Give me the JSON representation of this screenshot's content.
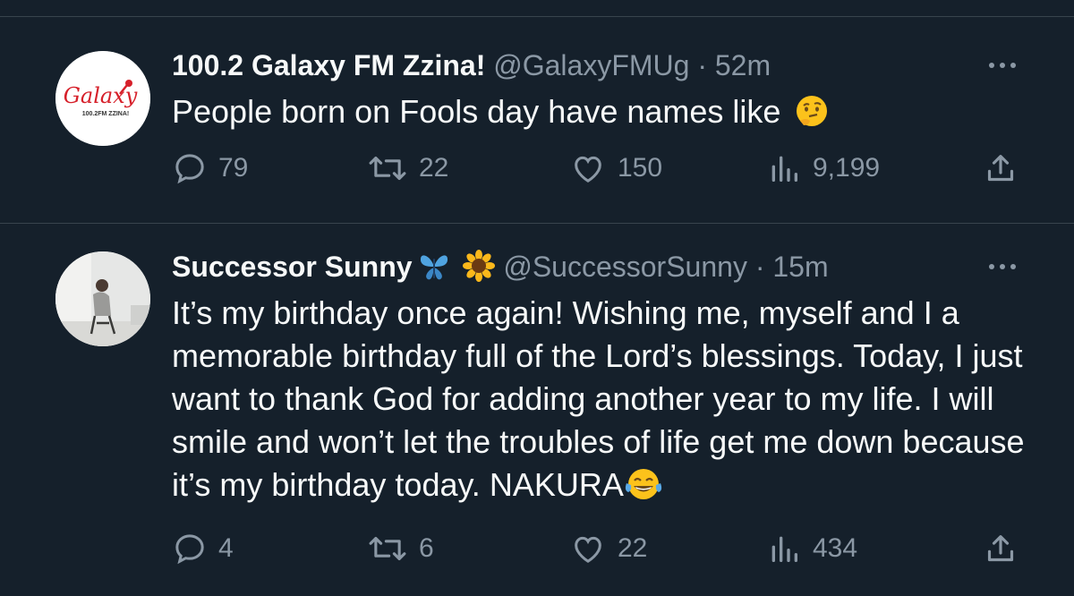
{
  "tweets": [
    {
      "name": "100.2 Galaxy FM Zzina!",
      "handle": "@GalaxyFMUg",
      "separator": "·",
      "time": "52m",
      "text": "People born on Fools day have names like",
      "text_emoji": "thinking-face-emoji",
      "avatar": {
        "logo_text": "Galaxy",
        "logo_subtext": "100.2FM ZZINA!",
        "brand_color": "#d6202a"
      },
      "stats": {
        "replies": "79",
        "retweets": "22",
        "likes": "150",
        "views": "9,199"
      }
    },
    {
      "name": "Successor Sunny",
      "name_emojis": [
        "butterfly-emoji",
        "sunflower-emoji"
      ],
      "handle": "@SuccessorSunny",
      "separator": "·",
      "time": "15m",
      "text": "It’s my birthday once again! Wishing me, myself and I a memorable birthday full of the Lord’s blessings. Today, I just want to thank God for adding another year to my life. I will smile and won’t let the troubles of life get me down because it’s my birthday today. NAKURA",
      "text_emoji": "tears-of-joy-emoji",
      "stats": {
        "replies": "4",
        "retweets": "6",
        "likes": "22",
        "views": "434"
      }
    }
  ],
  "colors": {
    "background": "#15202b",
    "text": "#f7f9f9",
    "muted": "#8b98a5",
    "divider": "#38444d"
  },
  "icons": [
    "reply-icon",
    "retweet-icon",
    "like-icon",
    "views-icon",
    "share-icon",
    "more-icon"
  ]
}
